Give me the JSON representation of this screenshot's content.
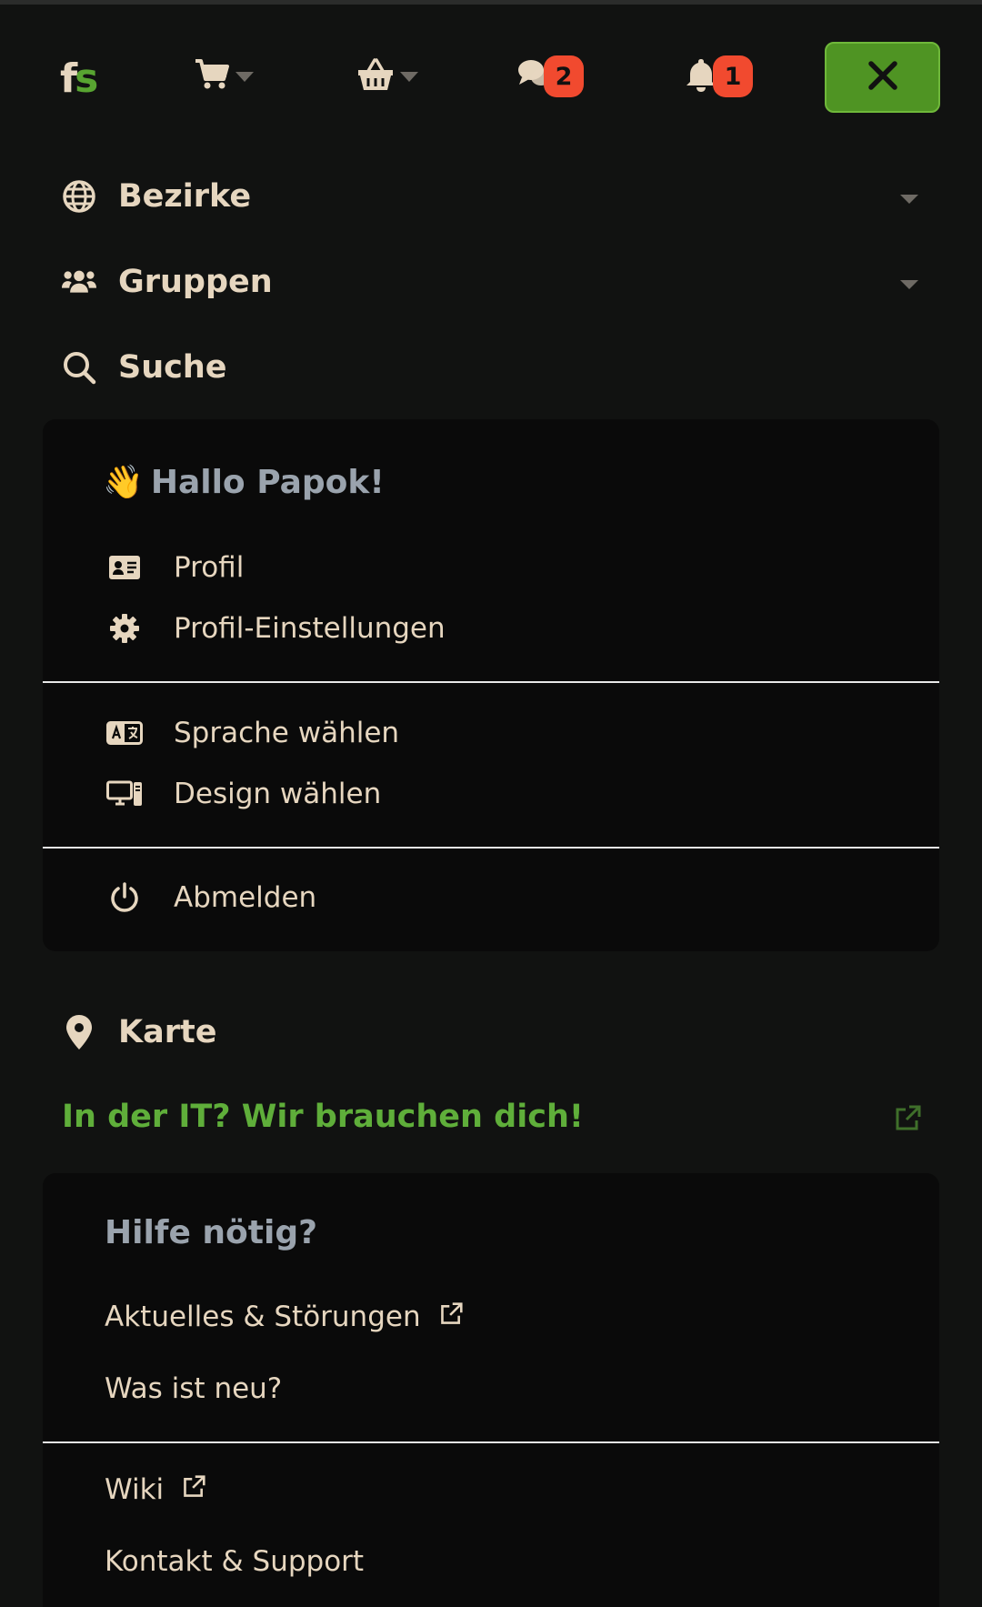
{
  "navbar": {
    "logo_f": "f",
    "logo_s": "s",
    "messages_count": "2",
    "notifications_count": "1"
  },
  "mainnav": {
    "districts": "Bezirke",
    "groups": "Gruppen",
    "search": "Suche"
  },
  "user_menu": {
    "greeting_emoji": "👋",
    "greeting": "Hallo Papok!",
    "profile": "Profil",
    "profile_settings": "Profil-Einstellungen",
    "language": "Sprache wählen",
    "design": "Design wählen",
    "logout": "Abmelden"
  },
  "map": "Karte",
  "it_banner": "In der IT? Wir brauchen dich!",
  "help_menu": {
    "title": "Hilfe nötig?",
    "news": "Aktuelles & Störungen",
    "whats_new": "Was ist neu?",
    "wiki": "Wiki",
    "contact": "Kontakt & Support"
  },
  "colors": {
    "background": "#111211",
    "panel": "#0a0a0a",
    "text": "#e6d6bf",
    "accent_green": "#58a431",
    "badge_red": "#f14a2f",
    "muted_title": "#9aa3ad"
  },
  "icons": [
    "shopping-cart-icon",
    "basket-icon",
    "chat-icon",
    "bell-icon",
    "close-icon",
    "globe-icon",
    "users-icon",
    "search-icon",
    "id-card-icon",
    "gear-icon",
    "language-icon",
    "computer-icon",
    "power-icon",
    "map-pin-icon",
    "external-link-icon"
  ]
}
